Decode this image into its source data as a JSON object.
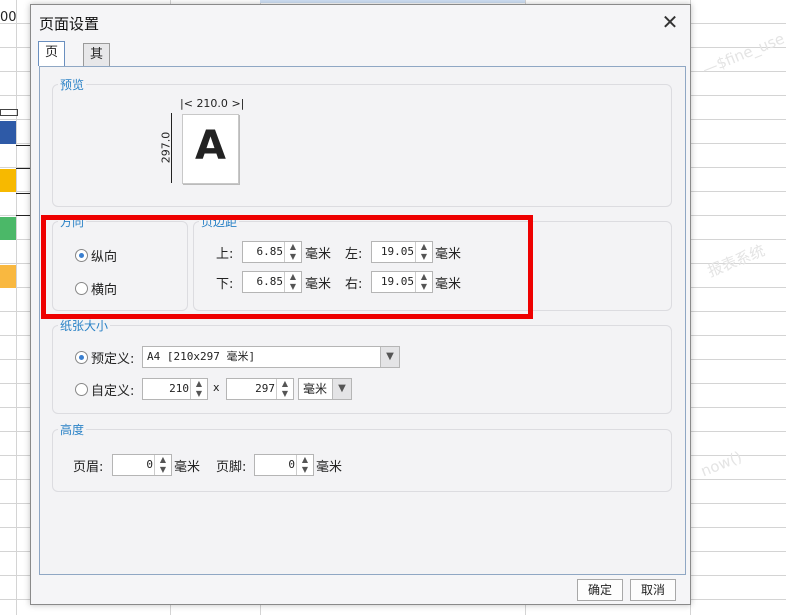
{
  "background": {
    "cell_value": "00",
    "watermark_1": "—$fine_use",
    "watermark_2": "now()",
    "watermark_3": "报表系统",
    "cell_colors": [
      "#2e5aa7",
      "#f7b900",
      "#4bb868",
      "#f9b840"
    ]
  },
  "dialog": {
    "title": "页面设置",
    "close": "✕",
    "tabs": [
      {
        "label": "页面"
      },
      {
        "label": "其他"
      }
    ]
  },
  "preview": {
    "group_title": "预览",
    "width_label": "210.0",
    "height_label": "297.0",
    "paper_letter": "A"
  },
  "orientation": {
    "group_title": "方向",
    "portrait": "纵向",
    "landscape": "横向",
    "selected": "portrait"
  },
  "margins": {
    "group_title": "页边距",
    "top_label": "上:",
    "top_value": "6.85",
    "bottom_label": "下:",
    "bottom_value": "6.85",
    "left_label": "左:",
    "left_value": "19.05",
    "right_label": "右:",
    "right_value": "19.05",
    "unit": "毫米"
  },
  "paper_size": {
    "group_title": "纸张大小",
    "predefined_label": "预定义:",
    "predefined_value": "A4 [210x297 毫米]",
    "custom_label": "自定义:",
    "custom_width": "210",
    "custom_x": "x",
    "custom_height": "297",
    "custom_unit": "毫米",
    "selected": "predefined"
  },
  "height": {
    "group_title": "高度",
    "header_label": "页眉:",
    "header_value": "0",
    "footer_label": "页脚:",
    "footer_value": "0",
    "unit": "毫米"
  },
  "buttons": {
    "ok": "确定",
    "cancel": "取消"
  },
  "highlight_color": "#ee0000"
}
